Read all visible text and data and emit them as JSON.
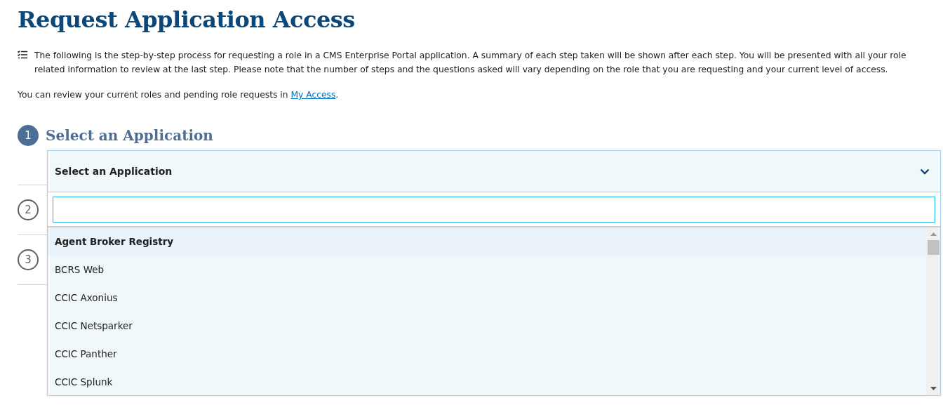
{
  "title": "Request Application Access",
  "intro": "The following is the step-by-step process for requesting a role in a CMS Enterprise Portal application. A summary of each step taken will be shown after each step. You will be presented with all your role related information to review at the last step. Please note that the number of steps and the questions asked will vary depending on the role that you are requesting and your current level of access.",
  "review": {
    "before": "You can review your current roles and pending role requests in",
    "link": "My Access",
    "after": "."
  },
  "steps": [
    {
      "number": "1",
      "title": "Select an Application",
      "active": true
    },
    {
      "number": "2",
      "active": false
    },
    {
      "number": "3",
      "active": false
    }
  ],
  "dropdown": {
    "label": "Select an Application",
    "expanded": true,
    "options": [
      {
        "label": "Agent Broker Registry",
        "highlighted": true
      },
      {
        "label": "BCRS Web",
        "highlighted": false
      },
      {
        "label": "CCIC Axonius",
        "highlighted": false
      },
      {
        "label": "CCIC Netsparker",
        "highlighted": false
      },
      {
        "label": "CCIC Panther",
        "highlighted": false
      },
      {
        "label": "CCIC Splunk",
        "highlighted": false
      }
    ]
  }
}
